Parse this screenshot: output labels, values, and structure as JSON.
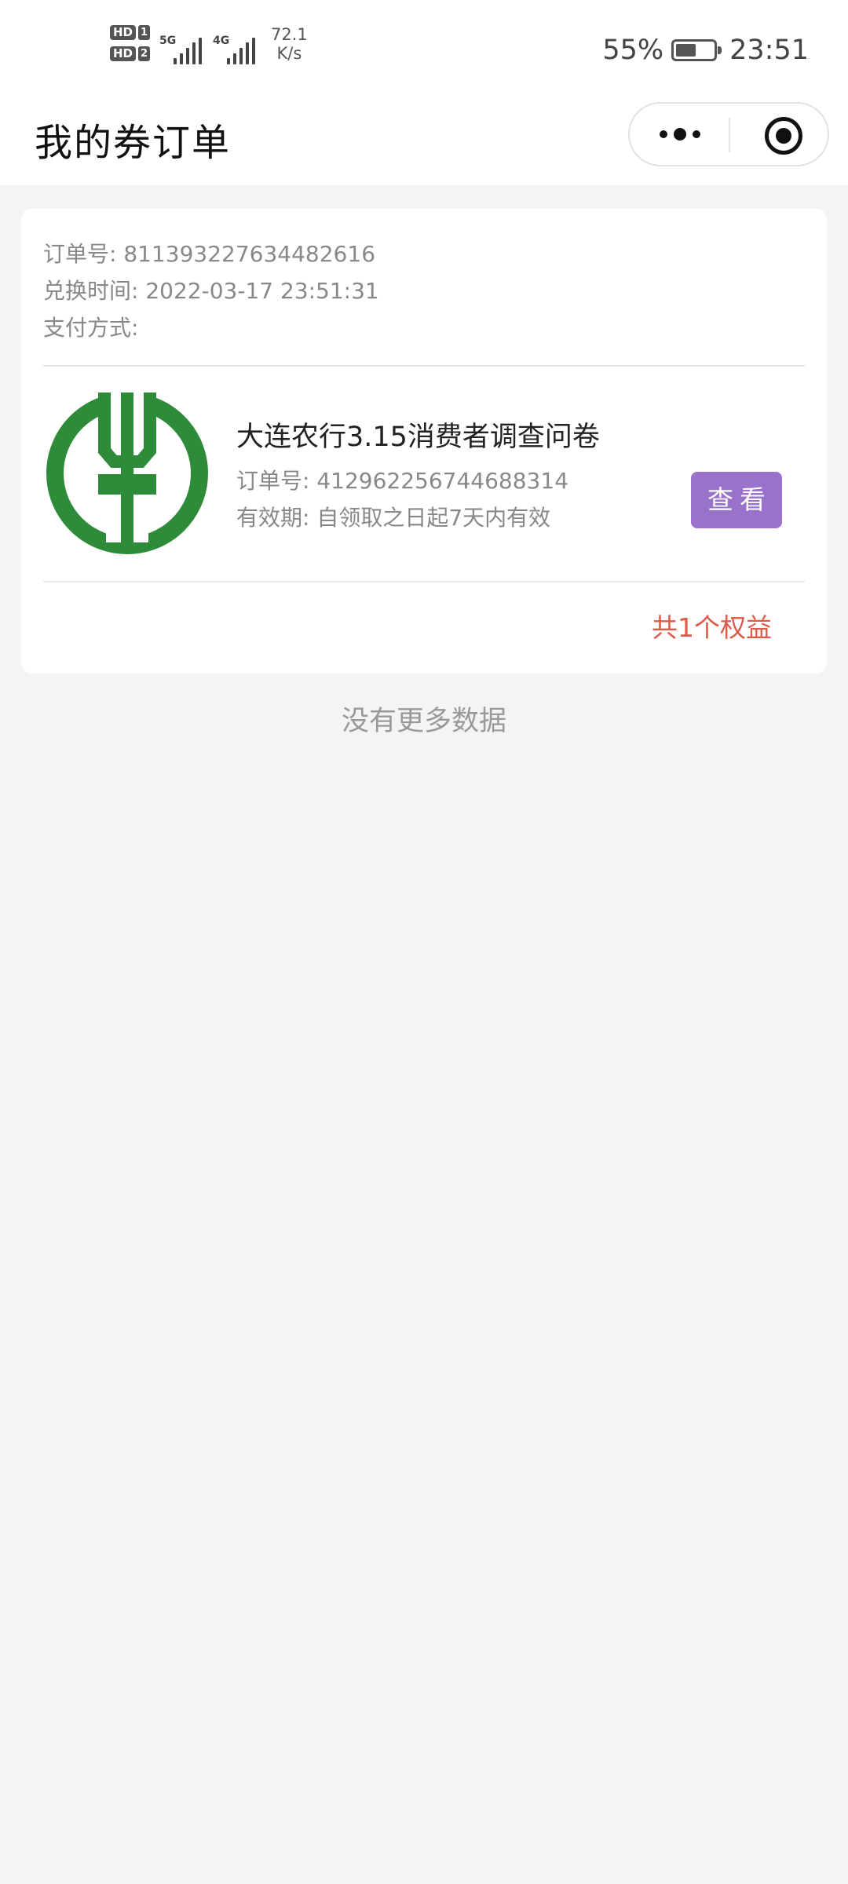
{
  "status_bar": {
    "sim1_label": "HD",
    "sim1_number": "1",
    "sim2_label": "HD",
    "sim2_number": "2",
    "network1_tech": "5G",
    "network2_tech": "4G",
    "net_speed_value": "72.1",
    "net_speed_unit": "K/s",
    "battery_percent": "55%",
    "battery_level": 0.55,
    "time": "23:51"
  },
  "navbar": {
    "title": "我的券订单",
    "more_icon": "more-dots-icon",
    "close_icon": "target-icon"
  },
  "order": {
    "order_no_label": "订单号:",
    "order_no": "811393227634482616",
    "exchange_time_label": "兑换时间:",
    "exchange_time": "2022-03-17 23:51:31",
    "payment_label": "支付方式:",
    "payment_value": "",
    "item": {
      "logo_icon": "agricultural-bank-logo",
      "title": "大连农行3.15消费者调查问卷",
      "order_no_label": "订单号:",
      "order_no": "412962256744688314",
      "validity_label": "有效期:",
      "validity": "自领取之日起7天内有效",
      "view_button": "查看"
    },
    "total_text": "共1个权益"
  },
  "footer": {
    "no_more": "没有更多数据"
  },
  "colors": {
    "accent_purple": "#9b72cb",
    "total_red": "#e05a4a",
    "logo_green": "#2e8b3a",
    "background": "#f4f4f4"
  }
}
